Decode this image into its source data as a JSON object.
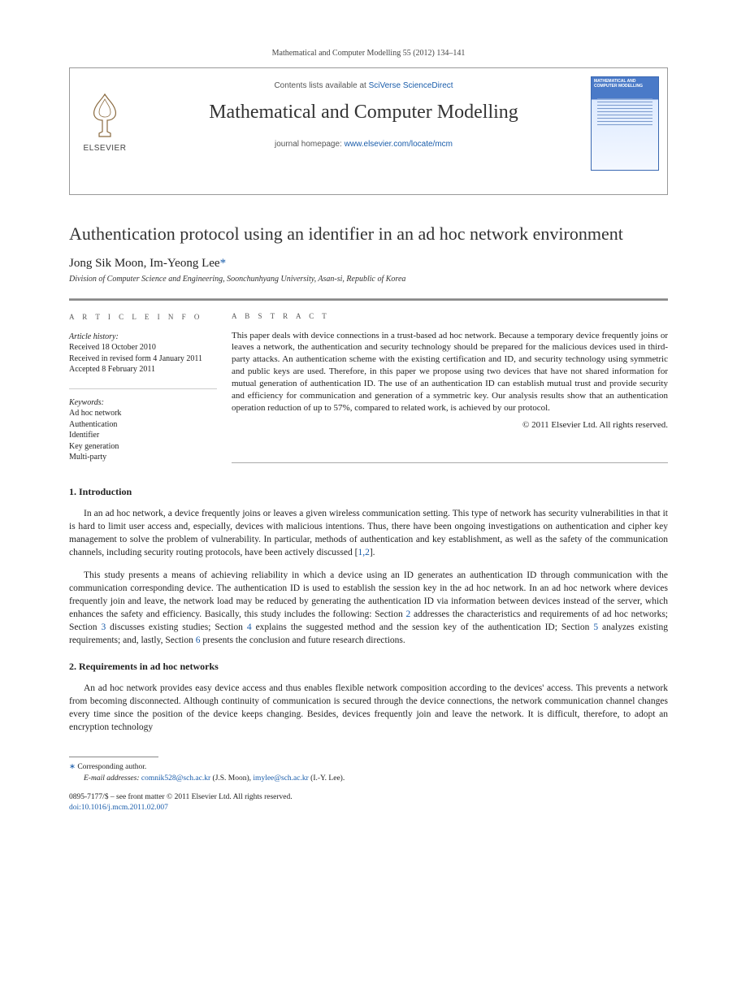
{
  "citation": "Mathematical and Computer Modelling 55 (2012) 134–141",
  "header": {
    "publisher_label": "ELSEVIER",
    "contents_prefix": "Contents lists available at ",
    "contents_link": "SciVerse ScienceDirect",
    "journal_name": "Mathematical and Computer Modelling",
    "homepage_prefix": "journal homepage: ",
    "homepage_link": "www.elsevier.com/locate/mcm",
    "cover_title": "MATHEMATICAL AND COMPUTER MODELLING"
  },
  "article": {
    "title": "Authentication protocol using an identifier in an ad hoc network environment",
    "authors_plain": "Jong Sik Moon, Im-Yeong Lee",
    "corr_mark": "*",
    "affiliation": "Division of Computer Science and Engineering, Soonchunhyang University, Asan-si, Republic of Korea"
  },
  "info": {
    "heading": "A R T I C L E   I N F O",
    "history_label": "Article history:",
    "received": "Received 18 October 2010",
    "revised": "Received in revised form 4 January 2011",
    "accepted": "Accepted 8 February 2011",
    "keywords_label": "Keywords:",
    "keywords": [
      "Ad hoc network",
      "Authentication",
      "Identifier",
      "Key generation",
      "Multi-party"
    ]
  },
  "abstract": {
    "heading": "A B S T R A C T",
    "text": "This paper deals with device connections in a trust-based ad hoc network. Because a temporary device frequently joins or leaves a network, the authentication and security technology should be prepared for the malicious devices used in third-party attacks. An authentication scheme with the existing certification and ID, and security technology using symmetric and public keys are used. Therefore, in this paper we propose using two devices that have not shared information for mutual generation of authentication ID. The use of an authentication ID can establish mutual trust and provide security and efficiency for communication and generation of a symmetric key. Our analysis results show that an authentication operation reduction of up to 57%, compared to related work, is achieved by our protocol.",
    "copyright": "© 2011 Elsevier Ltd. All rights reserved."
  },
  "sections": {
    "s1": {
      "heading": "1.  Introduction",
      "p1": "In an ad hoc network, a device frequently joins or leaves a given wireless communication setting. This type of network has security vulnerabilities in that it is hard to limit user access and, especially, devices with malicious intentions. Thus, there have been ongoing investigations on authentication and cipher key management to solve the problem of vulnerability. In particular, methods of authentication and key establishment, as well as the safety of the communication channels, including security routing protocols, have been actively discussed [",
      "p1_ref": "1,2",
      "p1_tail": "].",
      "p2a": "This study presents a means of achieving reliability in which a device using an ID generates an authentication ID through communication with the communication corresponding device. The authentication ID is used to establish the session key in the ad hoc network. In an ad hoc network where devices frequently join and leave, the network load may be reduced by generating the authentication ID via information between devices instead of the server, which enhances the safety and efficiency. Basically, this study includes the following: Section ",
      "p2_r2": "2",
      "p2b": " addresses the characteristics and requirements of ad hoc networks; Section ",
      "p2_r3": "3",
      "p2c": " discusses existing studies; Section ",
      "p2_r4": "4",
      "p2d": " explains the suggested method and the session key of the authentication ID; Section ",
      "p2_r5": "5",
      "p2e": " analyzes existing requirements; and, lastly, Section ",
      "p2_r6": "6",
      "p2f": " presents the conclusion and future research directions."
    },
    "s2": {
      "heading": "2.  Requirements in ad hoc networks",
      "p1": "An ad hoc network provides easy device access and thus enables flexible network composition according to the devices' access. This prevents a network from becoming disconnected. Although continuity of communication is secured through the device connections, the network communication channel changes every time since the position of the device keeps changing. Besides, devices frequently join and leave the network. It is difficult, therefore, to adopt an encryption technology"
    }
  },
  "footnotes": {
    "corr_label": "Corresponding author.",
    "email_label": "E-mail addresses:",
    "email1": "comnik528@sch.ac.kr",
    "email1_name": "(J.S. Moon),",
    "email2": "imylee@sch.ac.kr",
    "email2_name": "(I.-Y. Lee).",
    "line1": "0895-7177/$ – see front matter © 2011 Elsevier Ltd. All rights reserved.",
    "doi": "doi:10.1016/j.mcm.2011.02.007"
  }
}
